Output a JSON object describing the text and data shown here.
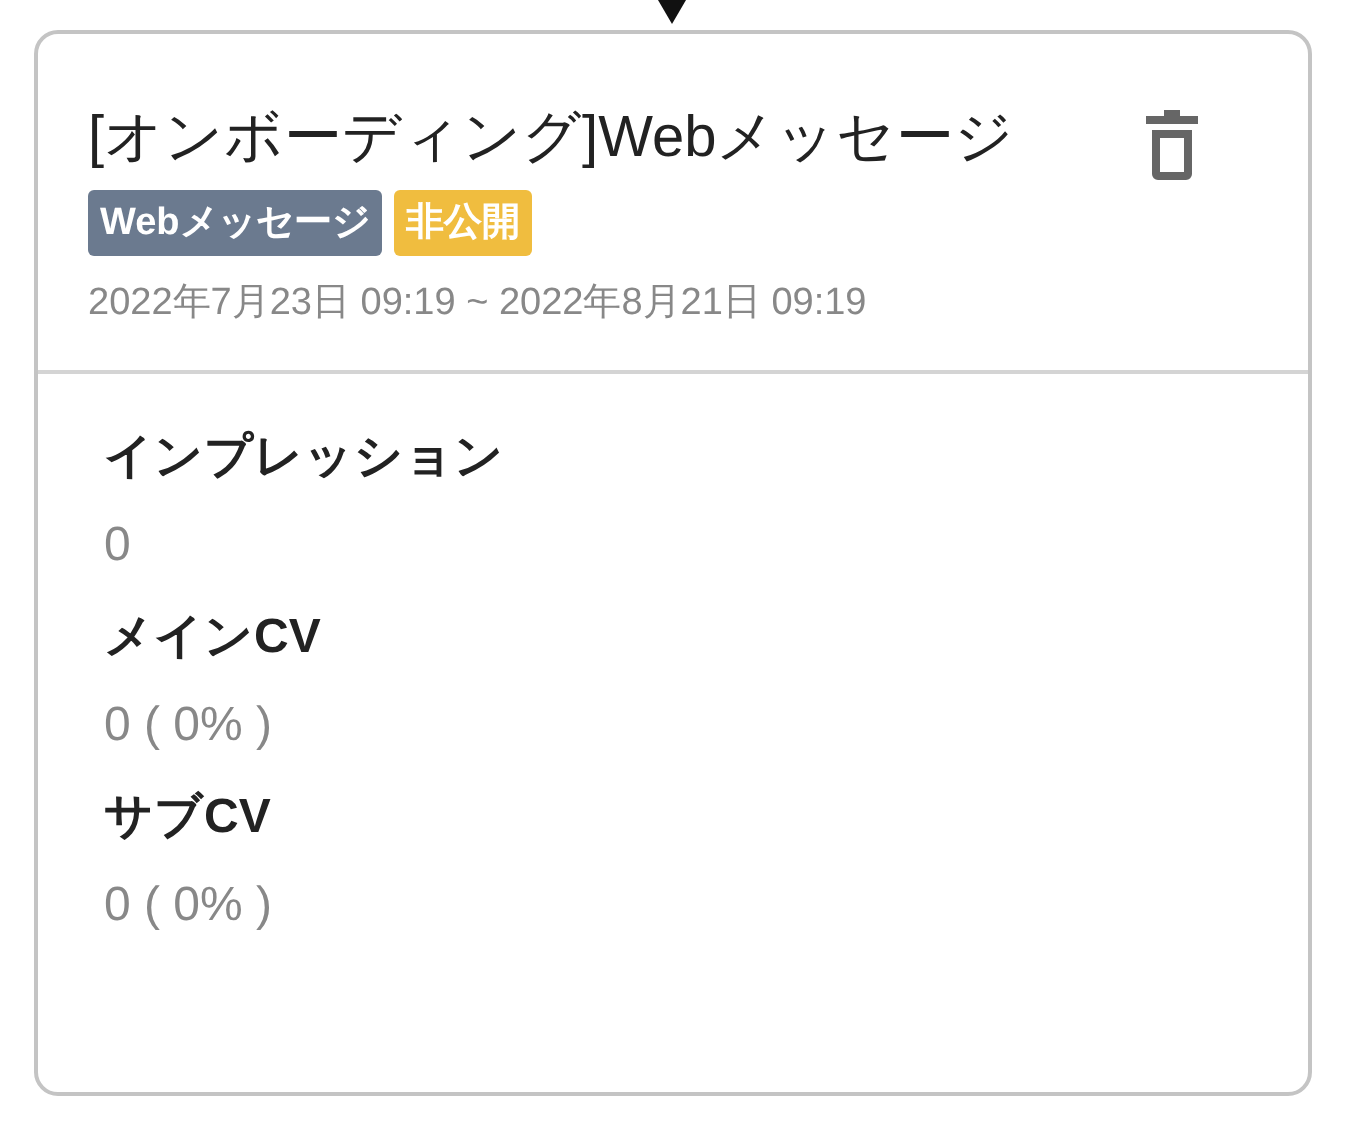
{
  "card": {
    "title": "[オンボーディング]Webメッセージ",
    "badges": [
      {
        "label": "Webメッセージ",
        "color": "#6b7a8f"
      },
      {
        "label": "非公開",
        "color": "#f0bd3f"
      }
    ],
    "period": "2022年7月23日 09:19 ~ 2022年8月21日 09:19",
    "metrics": [
      {
        "label": "インプレッション",
        "value": "0"
      },
      {
        "label": "メインCV",
        "value": "0 ( 0% )"
      },
      {
        "label": "サブCV",
        "value": "0 ( 0% )"
      }
    ]
  }
}
